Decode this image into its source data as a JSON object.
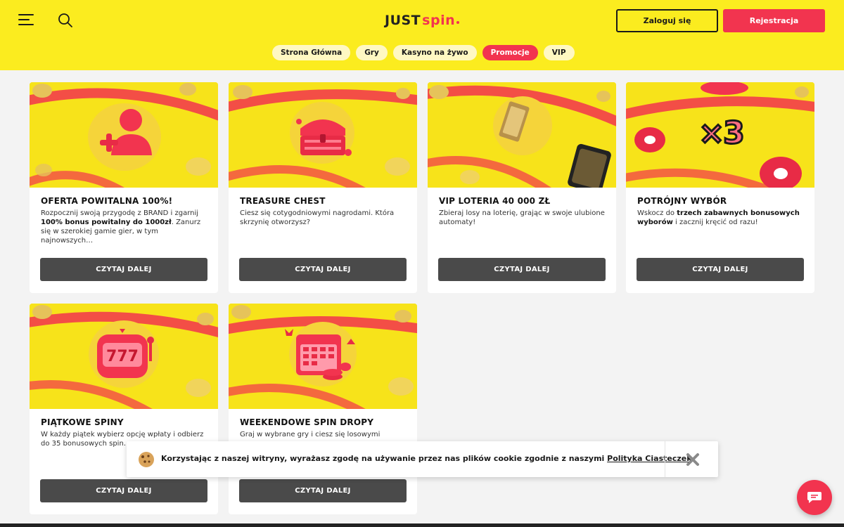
{
  "header": {
    "menu_icon": "hamburger-menu-icon",
    "search_icon": "search-icon",
    "logo": {
      "part1": "JUST",
      "part2": "spin"
    },
    "login_label": "Zaloguj się",
    "register_label": "Rejestracja",
    "accent_color": "#f2344f",
    "background_color": "#fbec1f"
  },
  "nav": {
    "items": [
      {
        "label": "Strona Główna",
        "active": false
      },
      {
        "label": "Gry",
        "active": false
      },
      {
        "label": "Kasyno na żywo",
        "active": false
      },
      {
        "label": "Promocje",
        "active": true
      },
      {
        "label": "VIP",
        "active": false
      }
    ]
  },
  "promotions": [
    {
      "title": "OFERTA POWITALNA 100%!",
      "desc_parts": [
        "Rozpocznij swoją przygodę z BRAND i zgarnij ",
        "100% bonus powitalny do 1000zł",
        ". Zanurz się w szerokiej gamie gier, w tym najnowszych…"
      ],
      "cta": "CZYTAJ DALEJ",
      "image_icon": "add-user-icon"
    },
    {
      "title": "TREASURE CHEST",
      "desc_parts": [
        "Ciesz się cotygodniowymi nagrodami. Która skrzynię otworzysz?"
      ],
      "cta": "CZYTAJ DALEJ",
      "image_icon": "treasure-chest-icon"
    },
    {
      "title": "VIP LOTERIA 40 000 ZŁ",
      "desc_parts": [
        "Zbieraj losy na loterię, grając w swoje ulubione automaty!"
      ],
      "cta": "CZYTAJ DALEJ",
      "image_icon": "vip-ticket-icon"
    },
    {
      "title": "POTRÓJNY WYBÓR",
      "desc_parts": [
        "Wskocz do ",
        "trzech zabawnych bonusowych wyborów",
        " i zacznij kręcić od razu!"
      ],
      "cta": "CZYTAJ DALEJ",
      "image_icon": "x3-icon"
    },
    {
      "title": "PIĄTKOWE SPINY",
      "desc_parts": [
        "W każdy piątek wybierz opcję wpłaty i odbierz do 35 bonusowych spin…"
      ],
      "cta": "CZYTAJ DALEJ",
      "image_icon": "slot-machine-icon"
    },
    {
      "title": "WEEKENDOWE SPIN DROPY",
      "desc_parts": [
        "Graj w wybrane gry i ciesz się losowymi"
      ],
      "cta": "CZYTAJ DALEJ",
      "image_icon": "calendar-chips-icon"
    }
  ],
  "cookie": {
    "text": "Korzystając z naszej witryny, wyrażasz zgodę na używanie przez nas plików cookie zgodnie z naszymi ",
    "link": "Polityka Ciasteczek",
    "icon": "cookie-icon",
    "close_icon": "close-icon"
  },
  "chat": {
    "icon": "chat-icon"
  }
}
